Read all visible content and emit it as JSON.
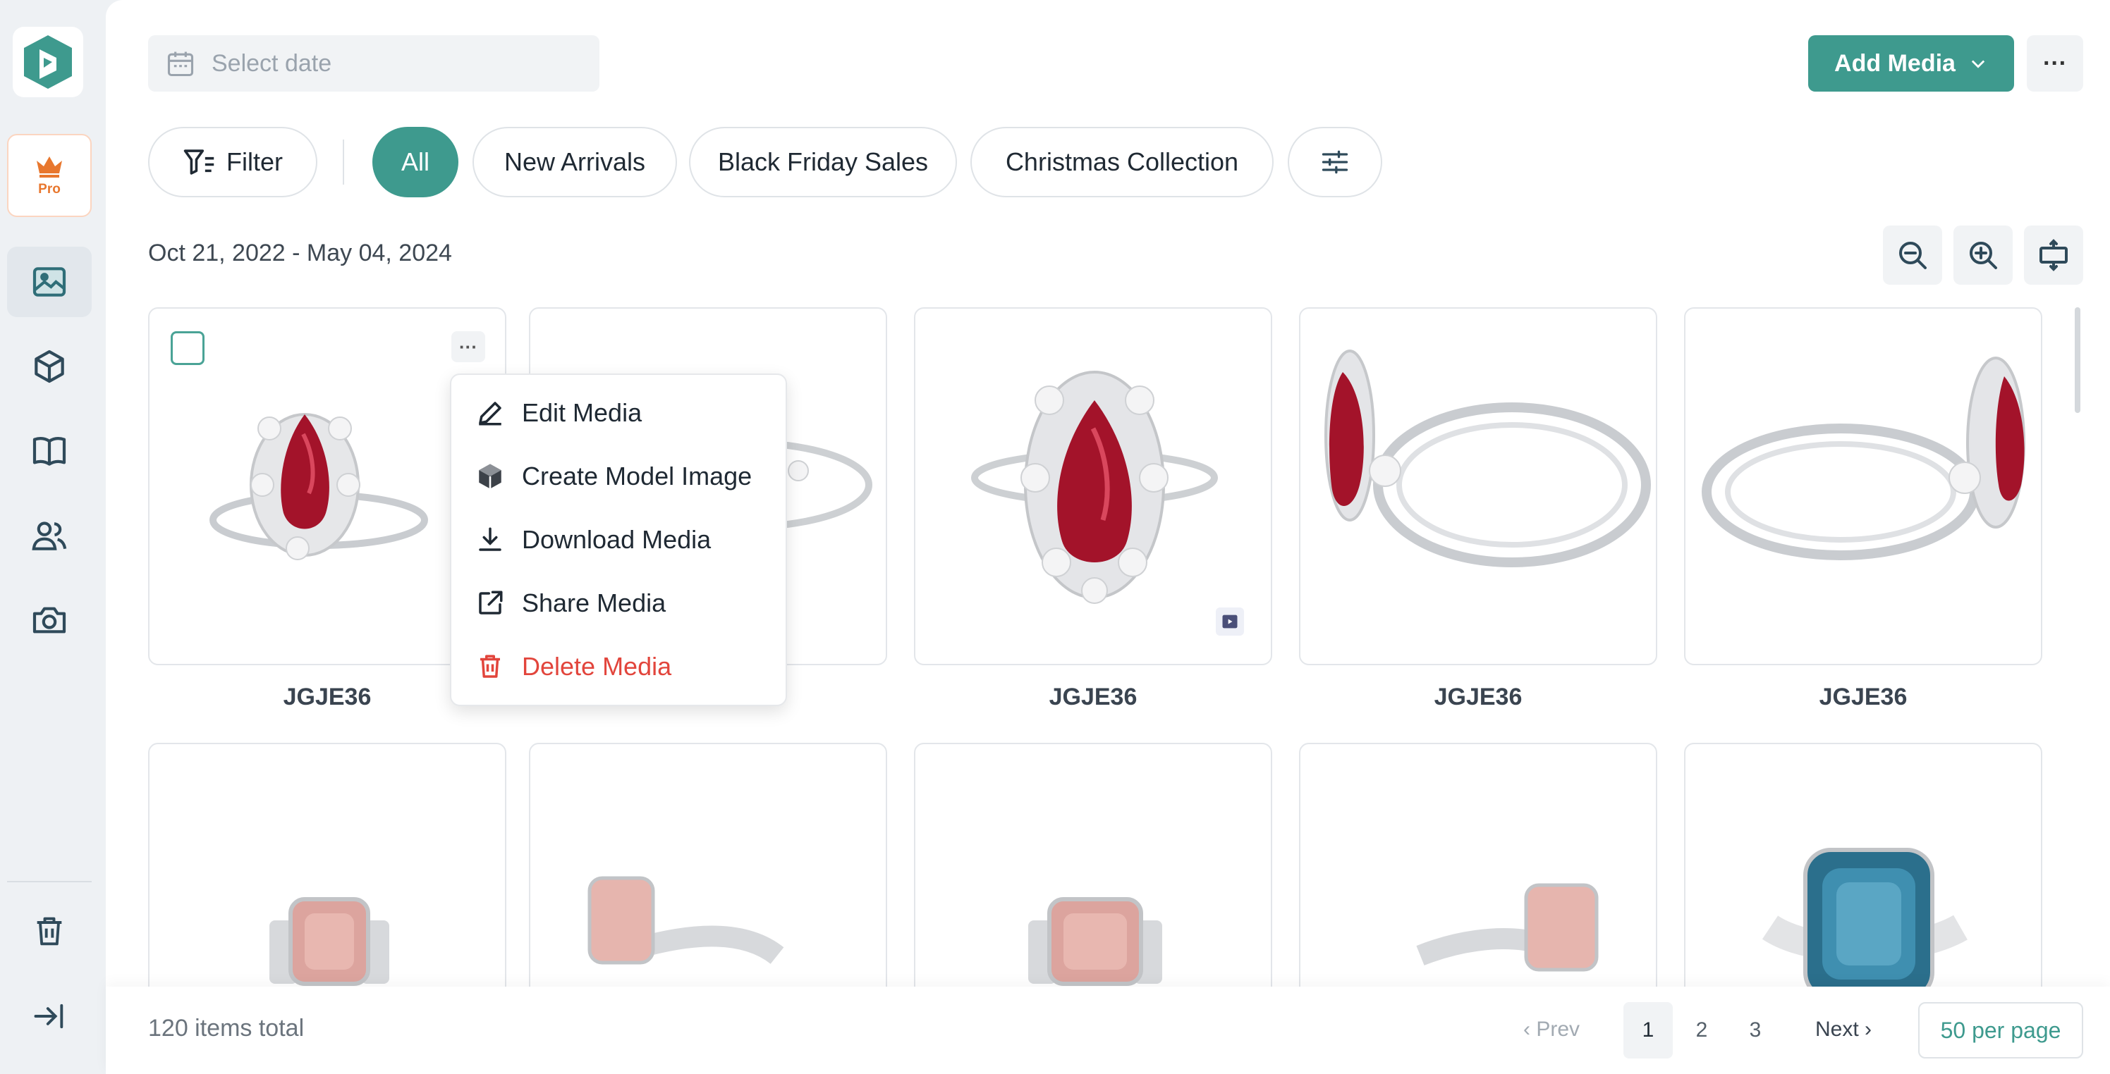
{
  "app": {
    "pro_label": "Pro"
  },
  "sidebar": {
    "items": [
      {
        "name": "media",
        "icon": "image-icon",
        "active": true
      },
      {
        "name": "products",
        "icon": "box-icon"
      },
      {
        "name": "catalogs",
        "icon": "book-icon"
      },
      {
        "name": "users",
        "icon": "users-icon"
      },
      {
        "name": "camera",
        "icon": "camera-icon"
      }
    ],
    "bottom": [
      {
        "icon": "trash-icon"
      },
      {
        "icon": "collapse-icon"
      }
    ]
  },
  "header": {
    "date_placeholder": "Select date",
    "add_media_label": "Add Media",
    "more_label": "···"
  },
  "filters": {
    "filter_label": "Filter",
    "chips": [
      "All",
      "New Arrivals",
      "Black Friday Sales",
      "Christmas Collection"
    ],
    "active_chip": "All"
  },
  "date_range": "Oct 21, 2022 - May 04, 2024",
  "cards": [
    {
      "name": "JGJE36"
    },
    {
      "name": "JGJE36"
    },
    {
      "name": "JGJE36"
    },
    {
      "name": "JGJE36"
    },
    {
      "name": "JGJE36"
    }
  ],
  "context_menu": {
    "items": [
      {
        "label": "Edit Media",
        "icon": "pencil-icon"
      },
      {
        "label": "Create Model Image",
        "icon": "model-icon"
      },
      {
        "label": "Download Media",
        "icon": "download-icon"
      },
      {
        "label": "Share Media",
        "icon": "share-icon"
      },
      {
        "label": "Delete Media",
        "icon": "trash-icon",
        "danger": true
      }
    ]
  },
  "footer": {
    "total": "120 items total",
    "prev": "‹ Prev",
    "pages": [
      "1",
      "2",
      "3"
    ],
    "current_page": "1",
    "next": "Next ›",
    "per_page": "50 per page"
  },
  "colors": {
    "accent": "#3e9a8e",
    "danger": "#e2453c",
    "pro": "#e8772e"
  }
}
